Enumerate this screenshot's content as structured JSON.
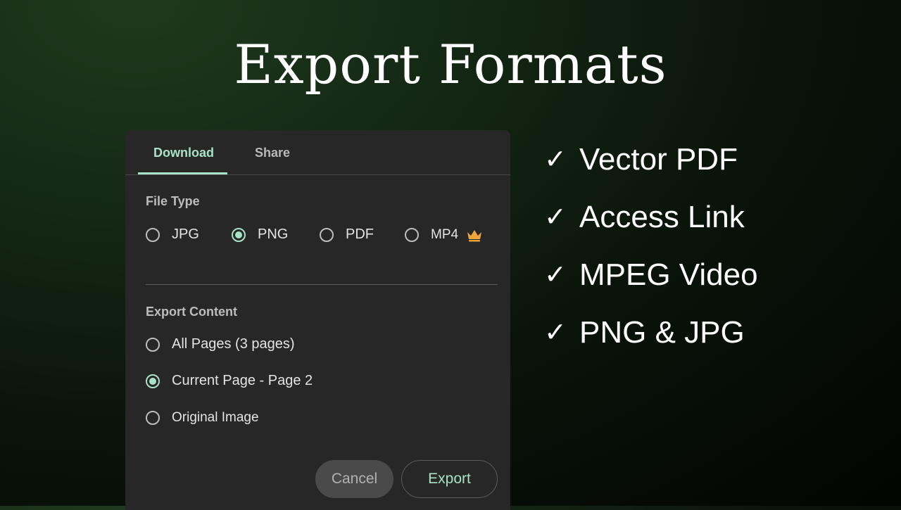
{
  "page": {
    "title": "Export Formats"
  },
  "dialog": {
    "tabs": [
      {
        "label": "Download",
        "active": true
      },
      {
        "label": "Share",
        "active": false
      }
    ],
    "file_type": {
      "label": "File Type",
      "options": [
        {
          "label": "JPG",
          "checked": false
        },
        {
          "label": "PNG",
          "checked": true
        },
        {
          "label": "PDF",
          "checked": false
        },
        {
          "label": "MP4",
          "checked": false,
          "icon": "crown-icon"
        }
      ]
    },
    "export_content": {
      "label": "Export Content",
      "options": [
        {
          "label": "All Pages (3 pages)",
          "checked": false
        },
        {
          "label": "Current Page - Page 2",
          "checked": true
        },
        {
          "label": "Original Image",
          "checked": false
        }
      ]
    },
    "buttons": {
      "cancel": "Cancel",
      "export": "Export"
    }
  },
  "features": [
    {
      "check": "✓",
      "label": "Vector PDF"
    },
    {
      "check": "✓",
      "label": "Access Link"
    },
    {
      "check": "✓",
      "label": "MPEG Video"
    },
    {
      "check": "✓",
      "label": "PNG & JPG"
    }
  ],
  "colors": {
    "accent": "#a8e2c8",
    "panel": "#272727",
    "premium": "#f0a43c"
  }
}
